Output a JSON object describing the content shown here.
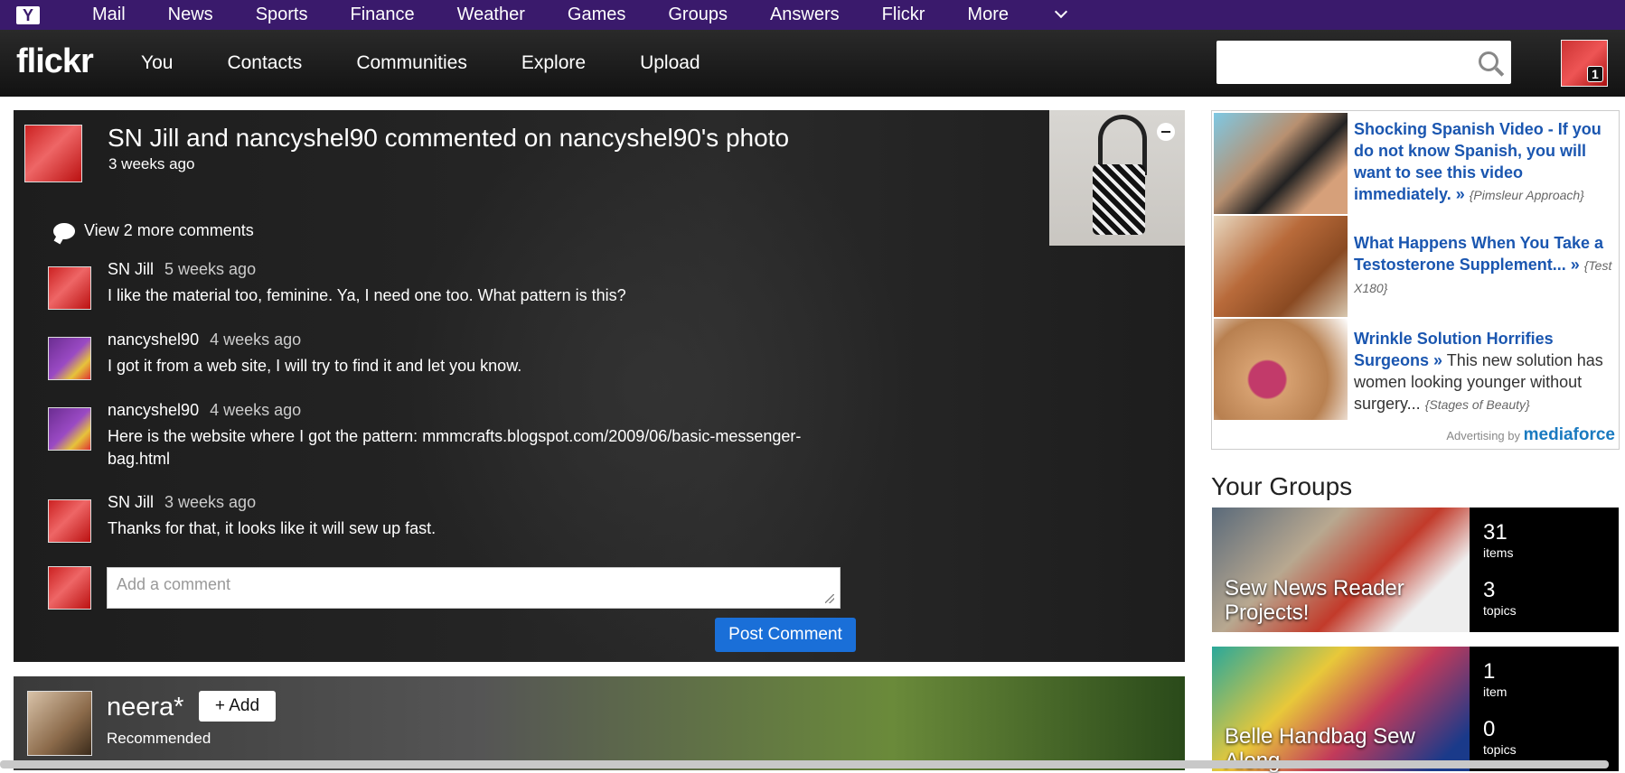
{
  "yahoo_nav": {
    "logo": "Y",
    "items": [
      "Mail",
      "News",
      "Sports",
      "Finance",
      "Weather",
      "Games",
      "Groups",
      "Answers",
      "Flickr",
      "More"
    ]
  },
  "flickr_nav": {
    "logo": "flickr",
    "items": [
      "You",
      "Contacts",
      "Communities",
      "Explore",
      "Upload"
    ],
    "search_placeholder": "",
    "notification_count": "1"
  },
  "activity": {
    "title": "SN Jill and nancyshel90 commented on nancyshel90's photo",
    "time": "3 weeks ago",
    "view_more": "View 2 more comments",
    "comments": [
      {
        "author": "SN Jill",
        "ago": "5 weeks ago",
        "text": "I like the material too, feminine. Ya, I need one too. What pattern is this?"
      },
      {
        "author": "nancyshel90",
        "ago": "4 weeks ago",
        "text": "I got it from a web site, I will try to find it and let you know."
      },
      {
        "author": "nancyshel90",
        "ago": "4 weeks ago",
        "text": "Here is the website where I got the pattern: mmmcrafts.blogspot.com/2009/06/basic-messenger-bag.html"
      },
      {
        "author": "SN Jill",
        "ago": "3 weeks ago",
        "text": "Thanks for that, it looks like it will sew up fast."
      }
    ],
    "comment_placeholder": "Add a comment",
    "post_button": "Post Comment"
  },
  "recommended": {
    "name": "neera*",
    "add_button": "+ Add",
    "label": "Recommended"
  },
  "ads": [
    {
      "title": "Shocking Spanish Video - If you do not know Spanish, you will want to see this video immediately. »",
      "body": "",
      "source": "{Pimsleur Approach}"
    },
    {
      "title": "What Happens When You Take a Testosterone Supplement... »",
      "body": "",
      "source": "{Test X180}"
    },
    {
      "title": "Wrinkle Solution Horrifies Surgeons »",
      "body": "This new solution has women looking younger without surgery...",
      "source": "{Stages of Beauty}"
    }
  ],
  "ad_credit": {
    "prefix": "Advertising by",
    "brand": "mediaforce"
  },
  "groups": {
    "title": "Your Groups",
    "items": [
      {
        "name": "Sew News Reader Projects!",
        "items_count": "31",
        "items_label": "items",
        "topics_count": "3",
        "topics_label": "topics"
      },
      {
        "name": "Belle Handbag Sew Along",
        "items_count": "1",
        "items_label": "item",
        "topics_count": "0",
        "topics_label": "topics"
      }
    ]
  },
  "colors": {
    "yahoo_purple": "#3a1a6c",
    "flickr_blue_button": "#1a6fd8",
    "ad_link": "#1a56b0"
  }
}
